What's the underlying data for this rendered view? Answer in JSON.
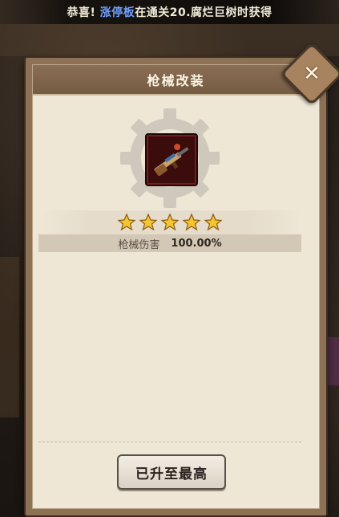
{
  "notice": {
    "prefix": "恭喜!",
    "player": "涨停板",
    "suffix": "在通关20.腐烂巨树时获得",
    "player_color": "#6fa0ff"
  },
  "dialog": {
    "title": "枪械改装",
    "close_icon": "close-x-icon",
    "weapon_icon": "rifle-icon",
    "stars": {
      "filled": 5,
      "total": 5,
      "color": "#f5c531"
    },
    "stat": {
      "label": "枪械伤害",
      "value": "100.00%"
    },
    "max_button_label": "已升至最高"
  }
}
